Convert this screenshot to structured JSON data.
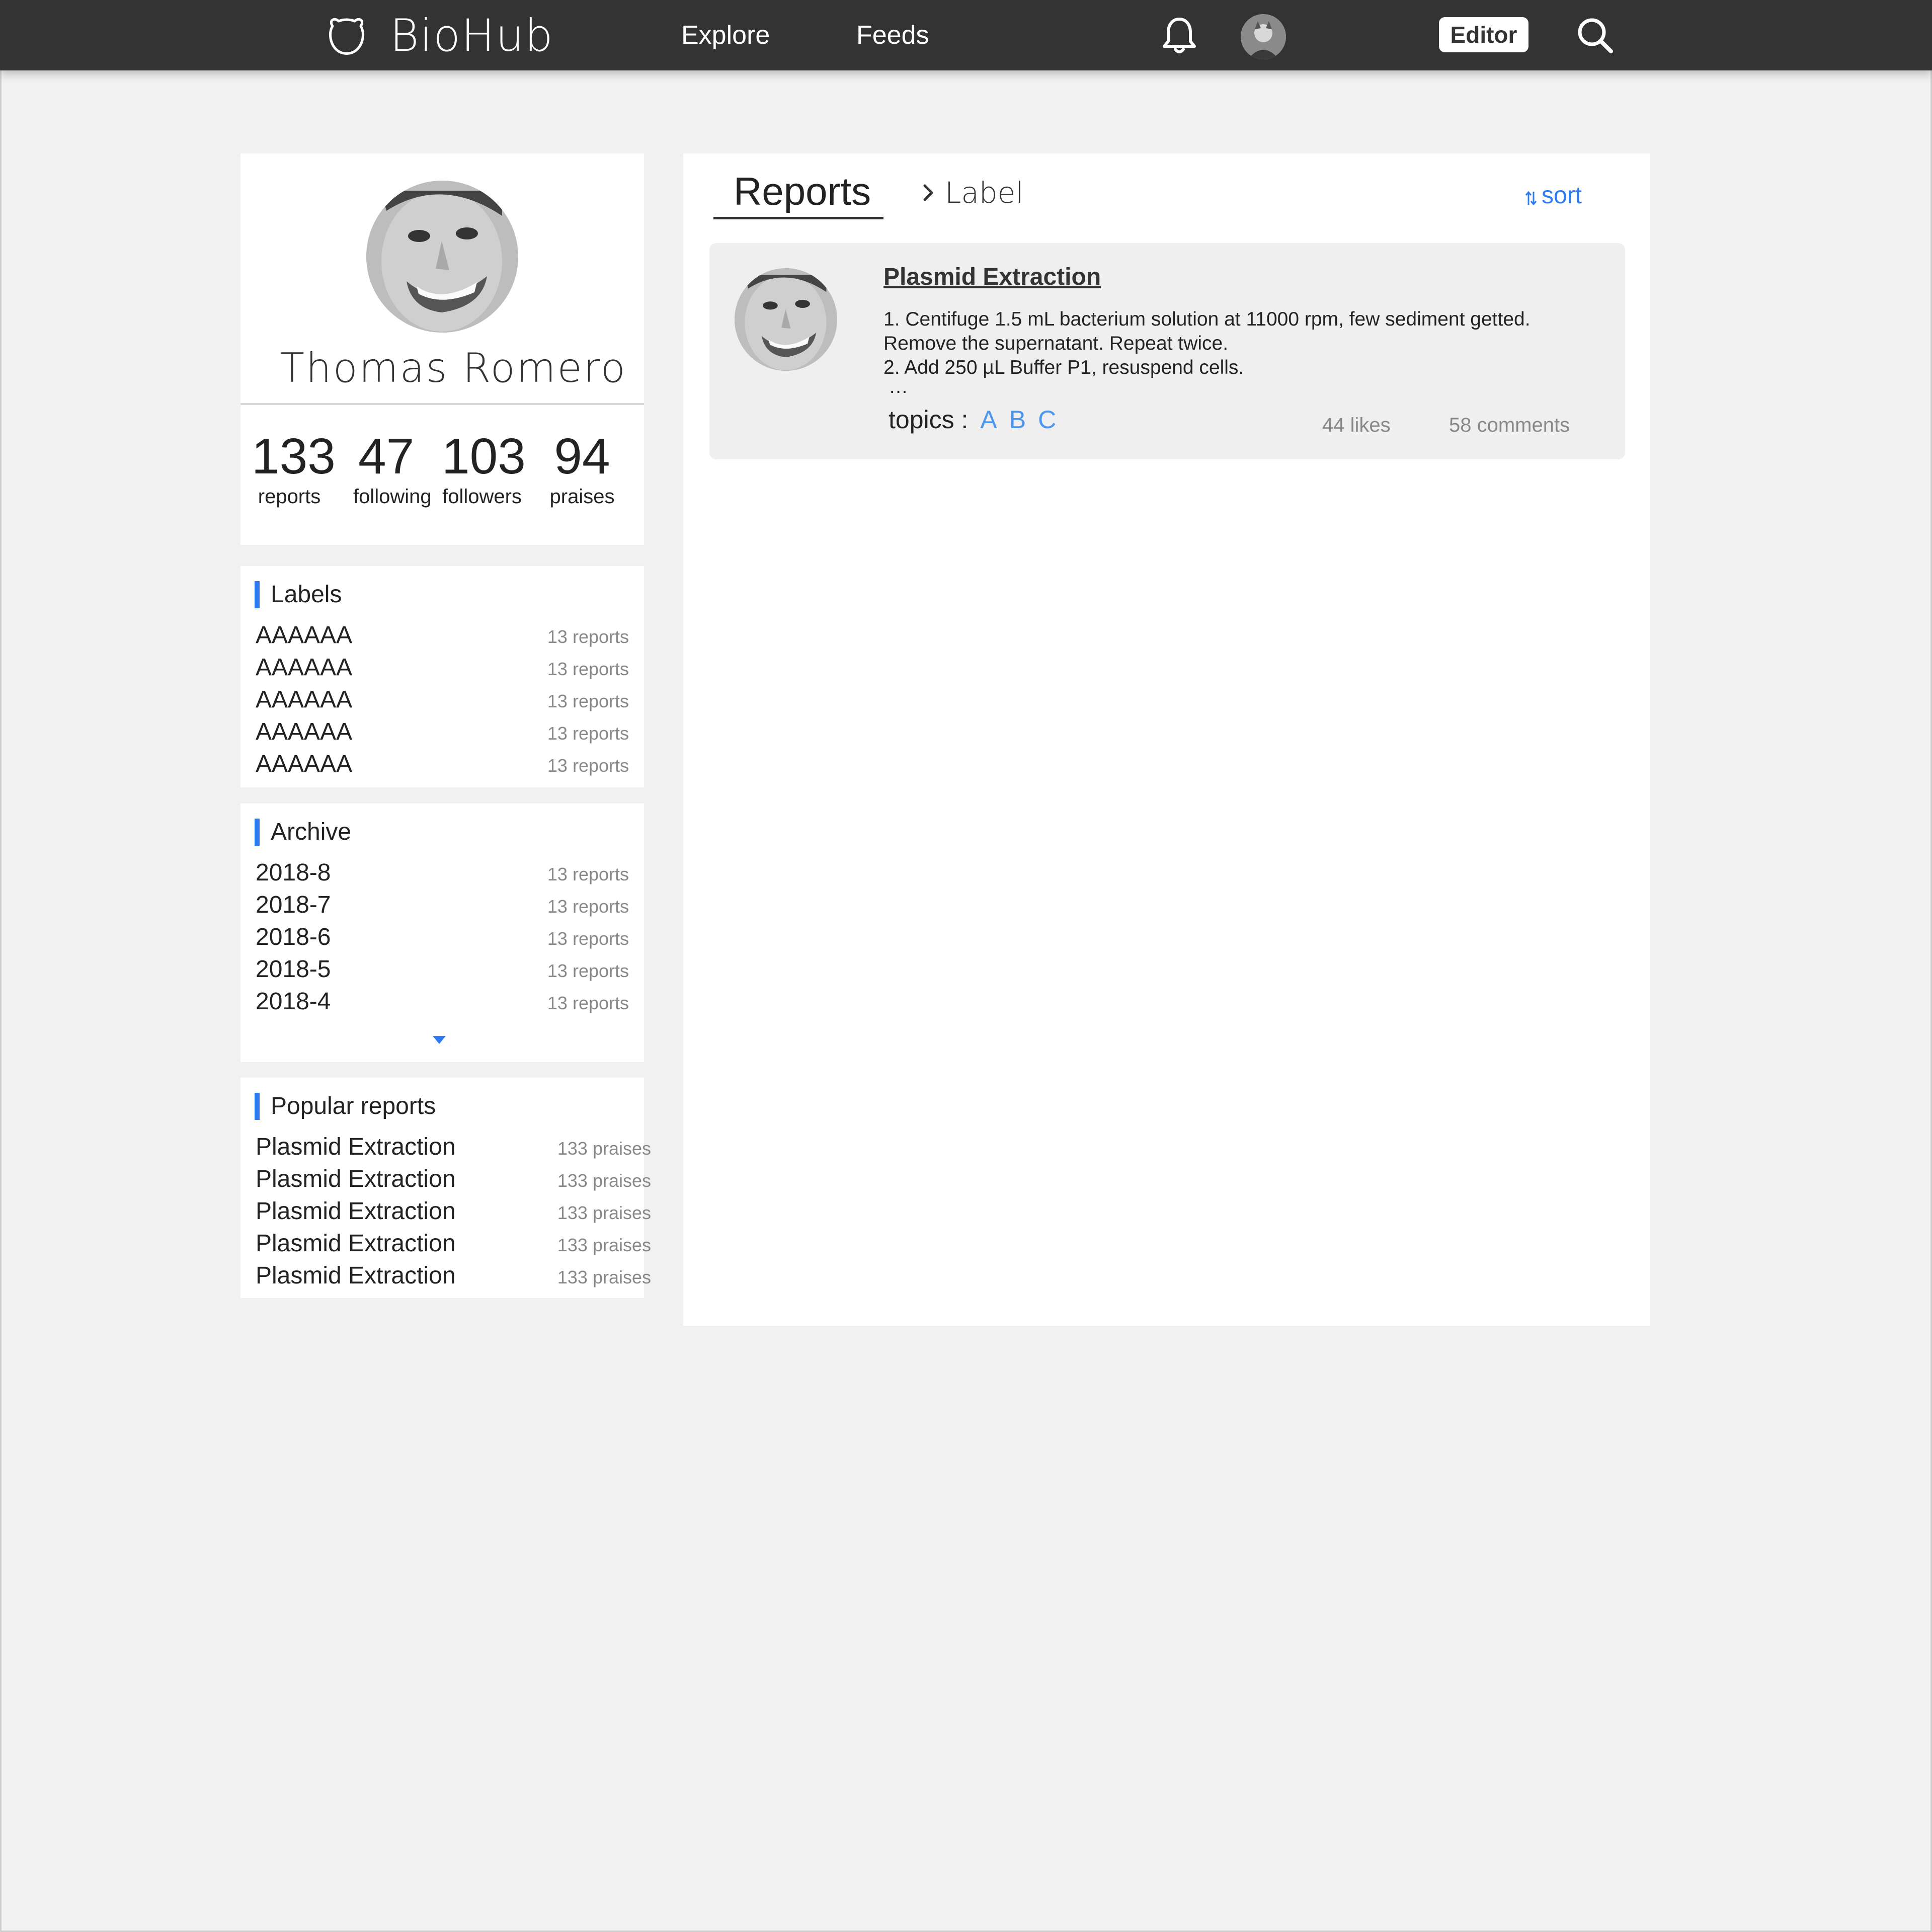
{
  "nav": {
    "brand": "BioHub",
    "links": [
      "Explore",
      "Feeds"
    ],
    "editor_label": "Editor"
  },
  "profile": {
    "name": "Thomas Romero",
    "stats": [
      {
        "value": "133",
        "label": "reports"
      },
      {
        "value": "47",
        "label": "following"
      },
      {
        "value": "103",
        "label": "followers"
      },
      {
        "value": "94",
        "label": "praises"
      }
    ]
  },
  "labels": {
    "title": "Labels",
    "items": [
      {
        "name": "AAAAAA",
        "count": "13 reports"
      },
      {
        "name": "AAAAAA",
        "count": "13 reports"
      },
      {
        "name": "AAAAAA",
        "count": "13 reports"
      },
      {
        "name": "AAAAAA",
        "count": "13 reports"
      },
      {
        "name": "AAAAAA",
        "count": "13 reports"
      }
    ]
  },
  "archive": {
    "title": "Archive",
    "items": [
      {
        "name": "2018-8",
        "count": "13 reports"
      },
      {
        "name": "2018-7",
        "count": "13 reports"
      },
      {
        "name": "2018-6",
        "count": "13 reports"
      },
      {
        "name": "2018-5",
        "count": "13 reports"
      },
      {
        "name": "2018-4",
        "count": "13 reports"
      }
    ]
  },
  "popular": {
    "title": "Popular reports",
    "items": [
      {
        "name": "Plasmid Extraction",
        "count": "133 praises"
      },
      {
        "name": "Plasmid Extraction",
        "count": "133 praises"
      },
      {
        "name": "Plasmid Extraction",
        "count": "133 praises"
      },
      {
        "name": "Plasmid Extraction",
        "count": "133 praises"
      },
      {
        "name": "Plasmid Extraction",
        "count": "133 praises"
      }
    ]
  },
  "main": {
    "tab": "Reports",
    "breadcrumb": "Label",
    "sort_label": "sort",
    "report": {
      "title": "Plasmid Extraction",
      "lines": [
        "1. Centifuge 1.5 mL bacterium solution at 11000 rpm, few sediment getted.",
        "Remove the supernatant. Repeat twice.",
        "2. Add 250 µL Buffer P1, resuspend cells.",
        "…"
      ],
      "topics_label": "topics :",
      "topics": [
        "A",
        "B",
        "C"
      ],
      "likes": "44 likes",
      "comments": "58 comments"
    }
  },
  "colors": {
    "nav_bg": "#333333",
    "accent": "#2d7bf0",
    "topic": "#4b96ee",
    "page_bg": "#f1f1f1"
  }
}
